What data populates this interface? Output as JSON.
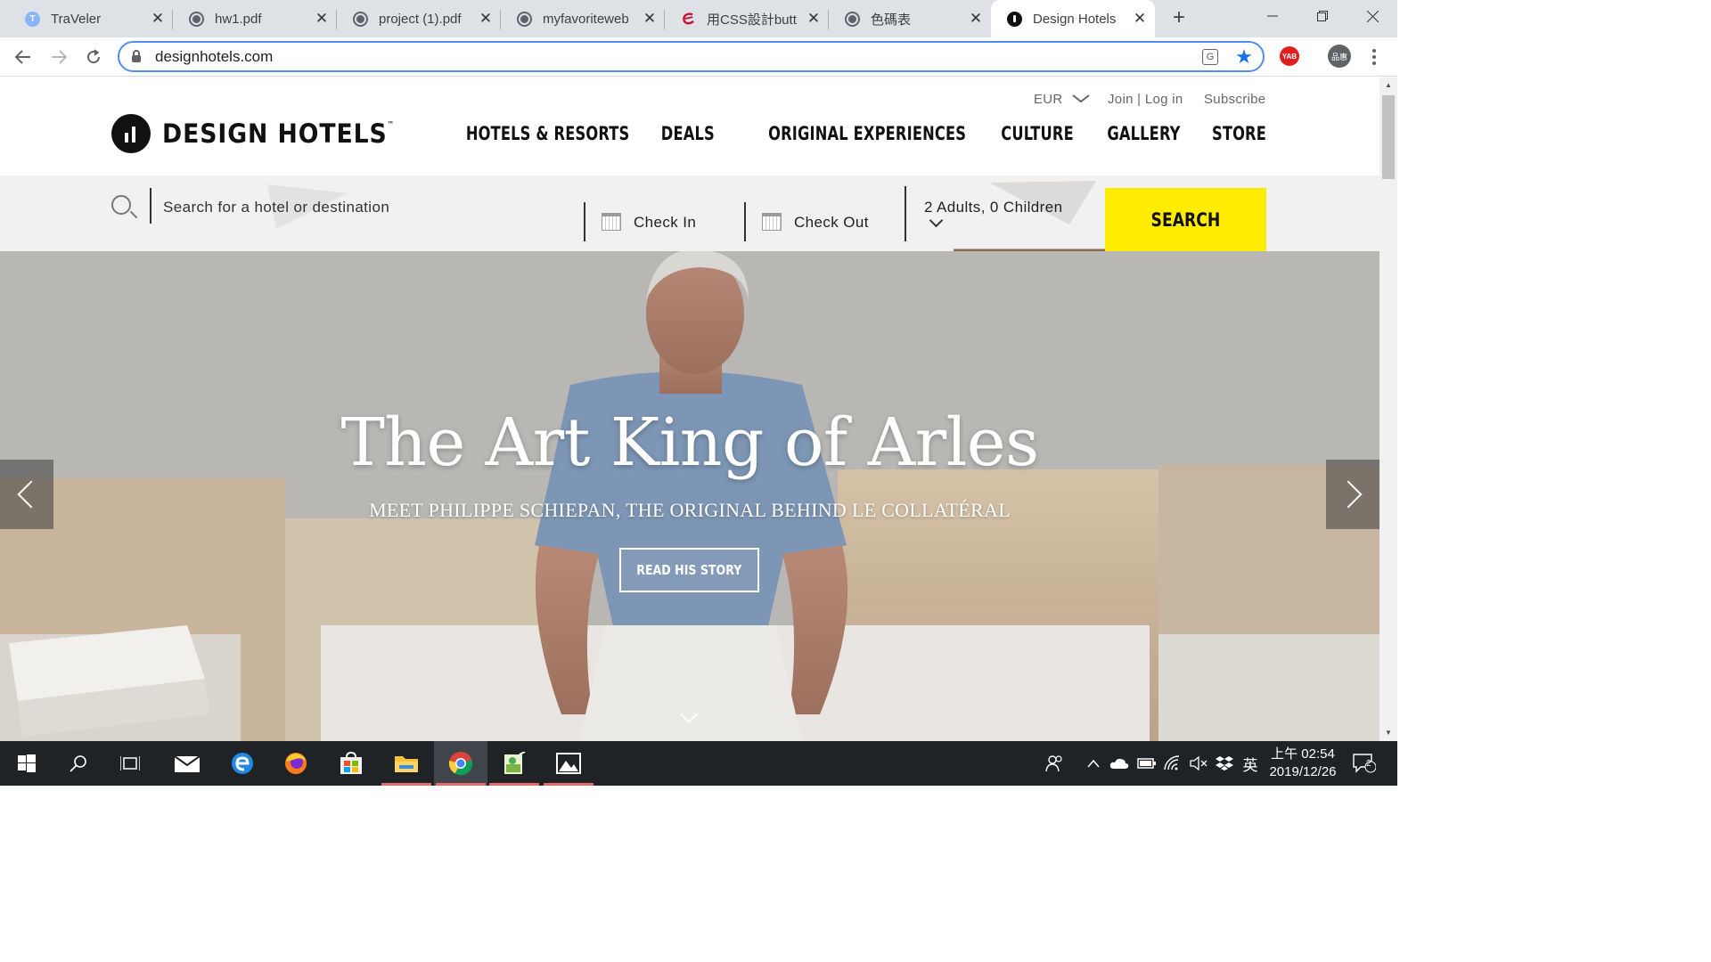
{
  "browser": {
    "tabs": [
      {
        "title": "TraVeler",
        "favicon": "t-letter-icon"
      },
      {
        "title": "hw1.pdf",
        "favicon": "globe-icon"
      },
      {
        "title": "project (1).pdf",
        "favicon": "globe-icon"
      },
      {
        "title": "myfavoriteweb",
        "favicon": "globe-icon"
      },
      {
        "title": "用CSS設計butt",
        "favicon": "e-letter-icon"
      },
      {
        "title": "色碼表",
        "favicon": "globe-icon"
      },
      {
        "title": "Design Hotels",
        "favicon": "design-hotels-icon"
      }
    ],
    "new_tab_label": "+",
    "tab_close_label": "✕",
    "url": "designhotels.com",
    "profile_initials": "品惠",
    "extension_label": "YAB",
    "translate_label": "G"
  },
  "site": {
    "utility_nav": {
      "currency": "EUR",
      "join_login": "Join | Log in",
      "subscribe": "Subscribe"
    },
    "logo": {
      "text": "DESIGN HOTELS",
      "tm": "™"
    },
    "main_nav": [
      "HOTELS & RESORTS",
      "DEALS",
      "ORIGINAL EXPERIENCES",
      "CULTURE",
      "GALLERY",
      "STORE"
    ],
    "search": {
      "destination_placeholder": "Search for a hotel or destination",
      "check_in": "Check In",
      "check_out": "Check Out",
      "guests": "2 Adults, 0 Children",
      "button": "SEARCH"
    },
    "hero": {
      "title": "The Art King of Arles",
      "subtitle": "MEET PHILIPPE SCHIEPAN, THE ORIGINAL BEHIND LE COLLATÉRAL",
      "cta": "READ HIS STORY"
    }
  },
  "taskbar": {
    "clock_time": "上午 02:54",
    "clock_date": "2019/12/26",
    "ime_label": "英",
    "notifications_count": "2"
  },
  "colors": {
    "accent_yellow": "#ffec00",
    "tab_strip": "#dee1e6",
    "taskbar": "#1f2326"
  }
}
